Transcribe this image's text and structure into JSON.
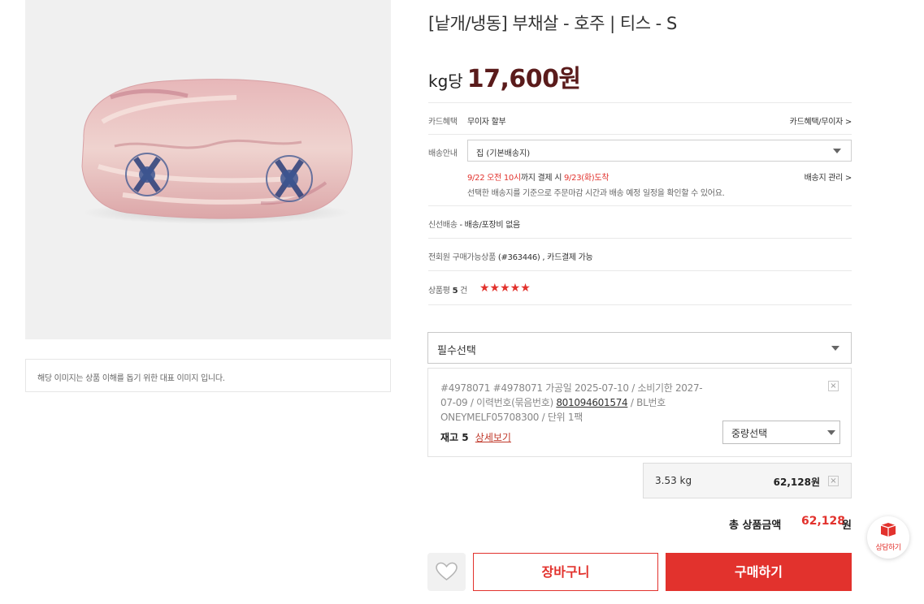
{
  "product": {
    "title": "[낱개/냉동] 부채살 - 호주 | 티스 - S",
    "price_unit": "kg당",
    "price": "17,600원",
    "image_caption": "해당 이미지는 상품 이해를 돕기 위한 대표 이미지 입니다."
  },
  "card": {
    "label": "카드혜택",
    "value": "무이자 할부",
    "link": "카드혜택/무이자 >"
  },
  "shipping": {
    "label": "배송안내",
    "selected": "집 (기본배송지)",
    "deadline_date": "9/22 오전 10시",
    "deadline_mid": "까지 결제 시",
    "arrival": "9/23(화)도착",
    "note": "선택한 배송지를 기준으로 주문마감 시간과 배송 예정 일정을 확인할 수 있어요.",
    "manage_link": "배송지 관리 >"
  },
  "fresh": {
    "label": "신선배송",
    "value": "- 배송/포장비 없음"
  },
  "availability": {
    "text": "전회원 구매가능상품",
    "code": "(#363446)",
    "card": ", 카드결제 가능"
  },
  "review": {
    "label": "상품평",
    "count": "5",
    "unit": "건",
    "stars": "★★★★★",
    "rating": 5
  },
  "required_select": {
    "label": "필수선택"
  },
  "option": {
    "info_prefix": "#4978071 #4978071 가공일 2025-07-10 / 소비기한 2027-07-09 / 이력번호(묶음번호)",
    "trace_no": "801094601574",
    "info_suffix": "/ BL번호 ONEYMELF05708300 / 단위 1팩",
    "stock_label": "재고 5",
    "detail_link": "상세보기",
    "weight_select": "중량선택",
    "remove": "×"
  },
  "selected_qty": {
    "weight": "3.53 kg",
    "amount": "62,128원",
    "remove": "×"
  },
  "total": {
    "label": "총 상품금액",
    "value": "62,128",
    "unit": "원"
  },
  "actions": {
    "cart": "장바구니",
    "buy": "구매하기",
    "consult": "상담하기"
  },
  "colors": {
    "accent": "#e2322d",
    "price": "#5a1b1b"
  },
  "icons": {
    "wishlist": "heart-icon",
    "consult": "chat-box-icon",
    "dropdown": "caret-down-icon"
  }
}
